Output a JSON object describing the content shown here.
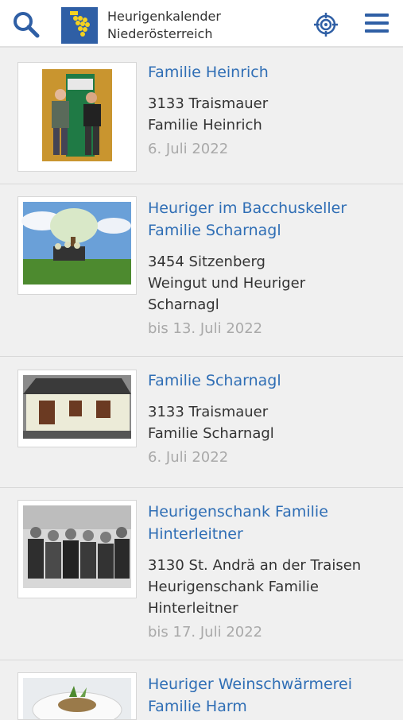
{
  "header": {
    "brand_line1": "Heurigenkalender",
    "brand_line2": "Niederösterreich",
    "search_icon": "search-icon",
    "locate_icon": "crosshair-icon",
    "menu_icon": "hamburger-menu-icon",
    "accent": "#2f5fa5"
  },
  "entries": [
    {
      "title_lines": [
        "Familie Heinrich"
      ],
      "address_lines": [
        "3133 Traismauer",
        "Familie Heinrich"
      ],
      "date": "6. Juli 2022"
    },
    {
      "title_lines": [
        "Heuriger im Bacchuskeller",
        "Familie Scharnagl"
      ],
      "address_lines": [
        "3454 Sitzenberg",
        "Weingut und Heuriger",
        "Scharnagl"
      ],
      "date": "bis 13. Juli 2022"
    },
    {
      "title_lines": [
        "Familie Scharnagl"
      ],
      "address_lines": [
        "3133 Traismauer",
        "Familie Scharnagl"
      ],
      "date": "6. Juli 2022"
    },
    {
      "title_lines": [
        "Heurigenschank Familie",
        "Hinterleitner"
      ],
      "address_lines": [
        "3130 St. Andrä an der Traisen",
        "Heurigenschank Familie",
        "Hinterleitner"
      ],
      "date": "bis 17. Juli 2022"
    },
    {
      "title_lines": [
        "Heuriger Weinschwärmerei",
        "Familie Harm"
      ],
      "address_lines": [],
      "date": ""
    }
  ],
  "colors": {
    "link": "#2f6eb5",
    "date": "#a9a9a9",
    "text": "#333333"
  }
}
